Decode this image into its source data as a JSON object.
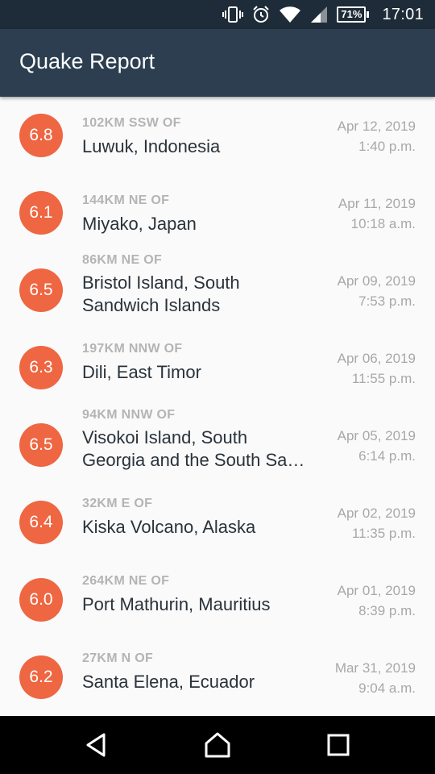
{
  "status_bar": {
    "battery": "71%",
    "time": "17:01",
    "icons": [
      "vibrate-icon",
      "alarm-icon",
      "wifi-icon",
      "signal-icon",
      "battery-icon"
    ]
  },
  "app_bar": {
    "title": "Quake Report"
  },
  "quakes": [
    {
      "magnitude": "6.8",
      "offset": "102KM SSW OF",
      "place_lines": [
        "Luwuk, Indonesia"
      ],
      "date": "Apr 12, 2019",
      "time": "1:40 p.m."
    },
    {
      "magnitude": "6.1",
      "offset": "144KM NE OF",
      "place_lines": [
        "Miyako, Japan"
      ],
      "date": "Apr 11, 2019",
      "time": "10:18 a.m."
    },
    {
      "magnitude": "6.5",
      "offset": "86KM NE OF",
      "place_lines": [
        "Bristol Island, South",
        "Sandwich Islands"
      ],
      "date": "Apr 09, 2019",
      "time": "7:53 p.m."
    },
    {
      "magnitude": "6.3",
      "offset": "197KM NNW OF",
      "place_lines": [
        "Dili, East Timor"
      ],
      "date": "Apr 06, 2019",
      "time": "11:55 p.m."
    },
    {
      "magnitude": "6.5",
      "offset": "94KM NNW OF",
      "place_lines": [
        "Visokoi Island, South",
        "Georgia and the South Sa…"
      ],
      "date": "Apr 05, 2019",
      "time": "6:14 p.m."
    },
    {
      "magnitude": "6.4",
      "offset": "32KM E OF",
      "place_lines": [
        "Kiska Volcano, Alaska"
      ],
      "date": "Apr 02, 2019",
      "time": "11:35 p.m."
    },
    {
      "magnitude": "6.0",
      "offset": "264KM NE OF",
      "place_lines": [
        "Port Mathurin, Mauritius"
      ],
      "date": "Apr 01, 2019",
      "time": "8:39 p.m."
    },
    {
      "magnitude": "6.2",
      "offset": "27KM N OF",
      "place_lines": [
        "Santa Elena, Ecuador"
      ],
      "date": "Mar 31, 2019",
      "time": "9:04 a.m."
    }
  ],
  "nav_bar": {
    "buttons": [
      "back-icon",
      "home-icon",
      "recents-icon"
    ]
  },
  "colors": {
    "status_bar": "#1E2B38",
    "app_bar": "#2C3E50",
    "magnitude_circle": "#EF6642",
    "background": "#FAFAFA"
  }
}
